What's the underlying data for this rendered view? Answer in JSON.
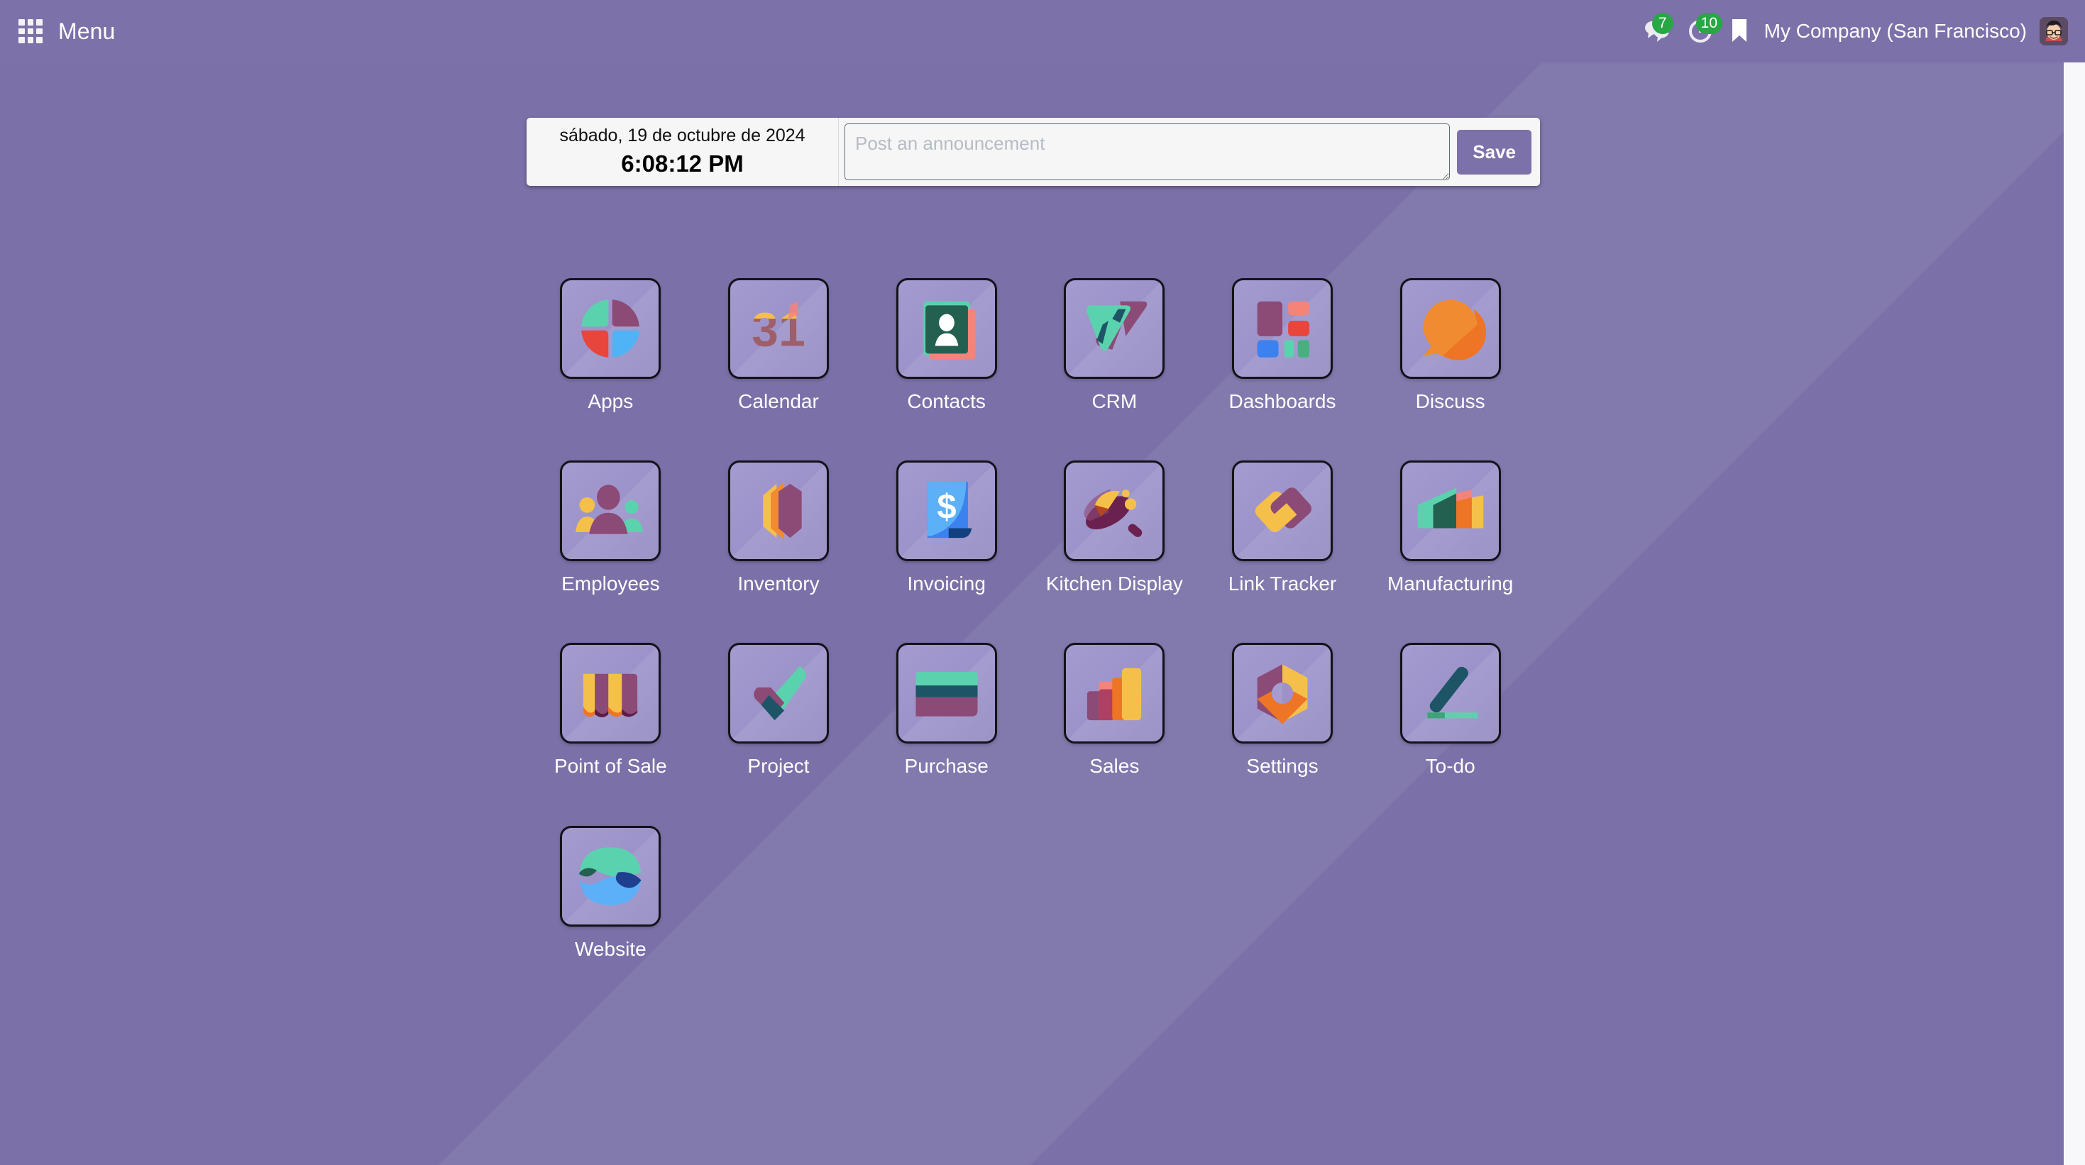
{
  "navbar": {
    "apps_menu_icon": "grid-apps-icon",
    "menu_label": "Menu",
    "messages": {
      "icon": "chat-bubbles-icon",
      "badge": "7"
    },
    "activities": {
      "icon": "clock-icon",
      "badge": "10"
    },
    "bookmark": {
      "icon": "bookmark-icon"
    },
    "company_name": "My Company (San Francisco)",
    "avatar": {
      "icon": "user-avatar"
    }
  },
  "announcement": {
    "date": "sábado, 19 de octubre de 2024",
    "time": "6:08:12 PM",
    "textarea_value": "",
    "textarea_placeholder": "Post an announcement",
    "save_label": "Save"
  },
  "colors": {
    "background": "#7b71a8",
    "navbar": "#7c71a9",
    "badge_green": "#28a745",
    "tile_face": "#9b92c9",
    "tile_border": "#14121a",
    "accent_purple": "#7c71a9"
  },
  "apps": [
    {
      "label": "Apps",
      "icon": "apps-pie-icon"
    },
    {
      "label": "Calendar",
      "icon": "calendar-31-icon"
    },
    {
      "label": "Contacts",
      "icon": "contacts-card-icon"
    },
    {
      "label": "CRM",
      "icon": "crm-arrow-icon"
    },
    {
      "label": "Dashboards",
      "icon": "dashboards-blocks-icon"
    },
    {
      "label": "Discuss",
      "icon": "discuss-bubble-icon"
    },
    {
      "label": "Employees",
      "icon": "employees-people-icon"
    },
    {
      "label": "Inventory",
      "icon": "inventory-box-icon"
    },
    {
      "label": "Invoicing",
      "icon": "invoicing-dollar-icon"
    },
    {
      "label": "Kitchen Display",
      "icon": "kitchen-pan-icon"
    },
    {
      "label": "Link Tracker",
      "icon": "link-tracker-chain-icon"
    },
    {
      "label": "Manufacturing",
      "icon": "manufacturing-bars-icon"
    },
    {
      "label": "Point of Sale",
      "icon": "pos-awning-icon"
    },
    {
      "label": "Project",
      "icon": "project-check-icon"
    },
    {
      "label": "Purchase",
      "icon": "purchase-card-icon"
    },
    {
      "label": "Sales",
      "icon": "sales-bars-icon"
    },
    {
      "label": "Settings",
      "icon": "settings-hex-icon"
    },
    {
      "label": "To-do",
      "icon": "todo-pen-icon"
    },
    {
      "label": "Website",
      "icon": "website-globe-icon"
    }
  ]
}
